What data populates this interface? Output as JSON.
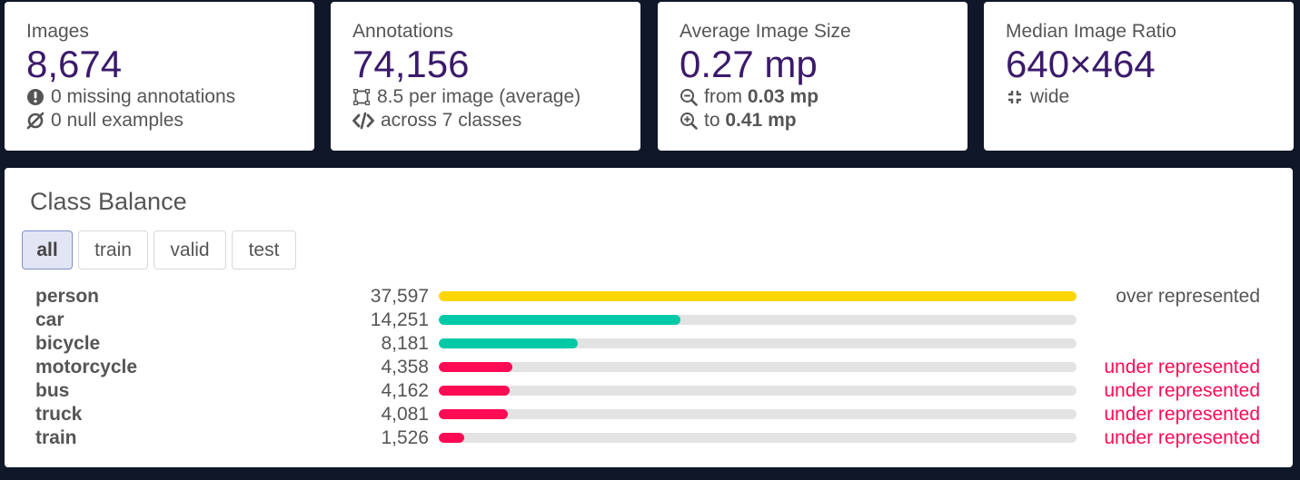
{
  "stats": {
    "images": {
      "label": "Images",
      "value": "8,674",
      "line1": "0 missing annotations",
      "line2": "0 null examples"
    },
    "annotations": {
      "label": "Annotations",
      "value": "74,156",
      "line1": "8.5 per image (average)",
      "line2": "across 7 classes"
    },
    "avg_size": {
      "label": "Average Image Size",
      "value": "0.27 mp",
      "from_prefix": "from",
      "from_value": "0.03 mp",
      "to_prefix": "to",
      "to_value": "0.41 mp"
    },
    "ratio": {
      "label": "Median Image Ratio",
      "value": "640×464",
      "line1": "wide"
    }
  },
  "balance": {
    "title": "Class Balance",
    "tabs": [
      "all",
      "train",
      "valid",
      "test"
    ],
    "active_tab": "all",
    "max_count": 37597,
    "classes": [
      {
        "name": "person",
        "count_label": "37,597",
        "count": 37597,
        "status": "over represented",
        "kind": "over"
      },
      {
        "name": "car",
        "count_label": "14,251",
        "count": 14251,
        "status": "",
        "kind": "normal"
      },
      {
        "name": "bicycle",
        "count_label": "8,181",
        "count": 8181,
        "status": "",
        "kind": "normal"
      },
      {
        "name": "motorcycle",
        "count_label": "4,358",
        "count": 4358,
        "status": "under represented",
        "kind": "under"
      },
      {
        "name": "bus",
        "count_label": "4,162",
        "count": 4162,
        "status": "under represented",
        "kind": "under"
      },
      {
        "name": "truck",
        "count_label": "4,081",
        "count": 4081,
        "status": "under represented",
        "kind": "under"
      },
      {
        "name": "train",
        "count_label": "1,526",
        "count": 1526,
        "status": "under represented",
        "kind": "under"
      }
    ]
  },
  "colors": {
    "background": "#0f1729",
    "value_purple": "#3b1a6b",
    "over": "#ffd600",
    "normal": "#00c9a7",
    "under": "#ff0a54",
    "under_text": "#ff0a54",
    "over_text": "#555555"
  },
  "icons": {
    "missing": "exclamation-circle-icon",
    "null": "empty-set-icon",
    "per_image": "bounding-box-icon",
    "classes": "code-icon",
    "from": "zoom-out-icon",
    "to": "zoom-in-icon",
    "ratio": "compress-icon"
  }
}
